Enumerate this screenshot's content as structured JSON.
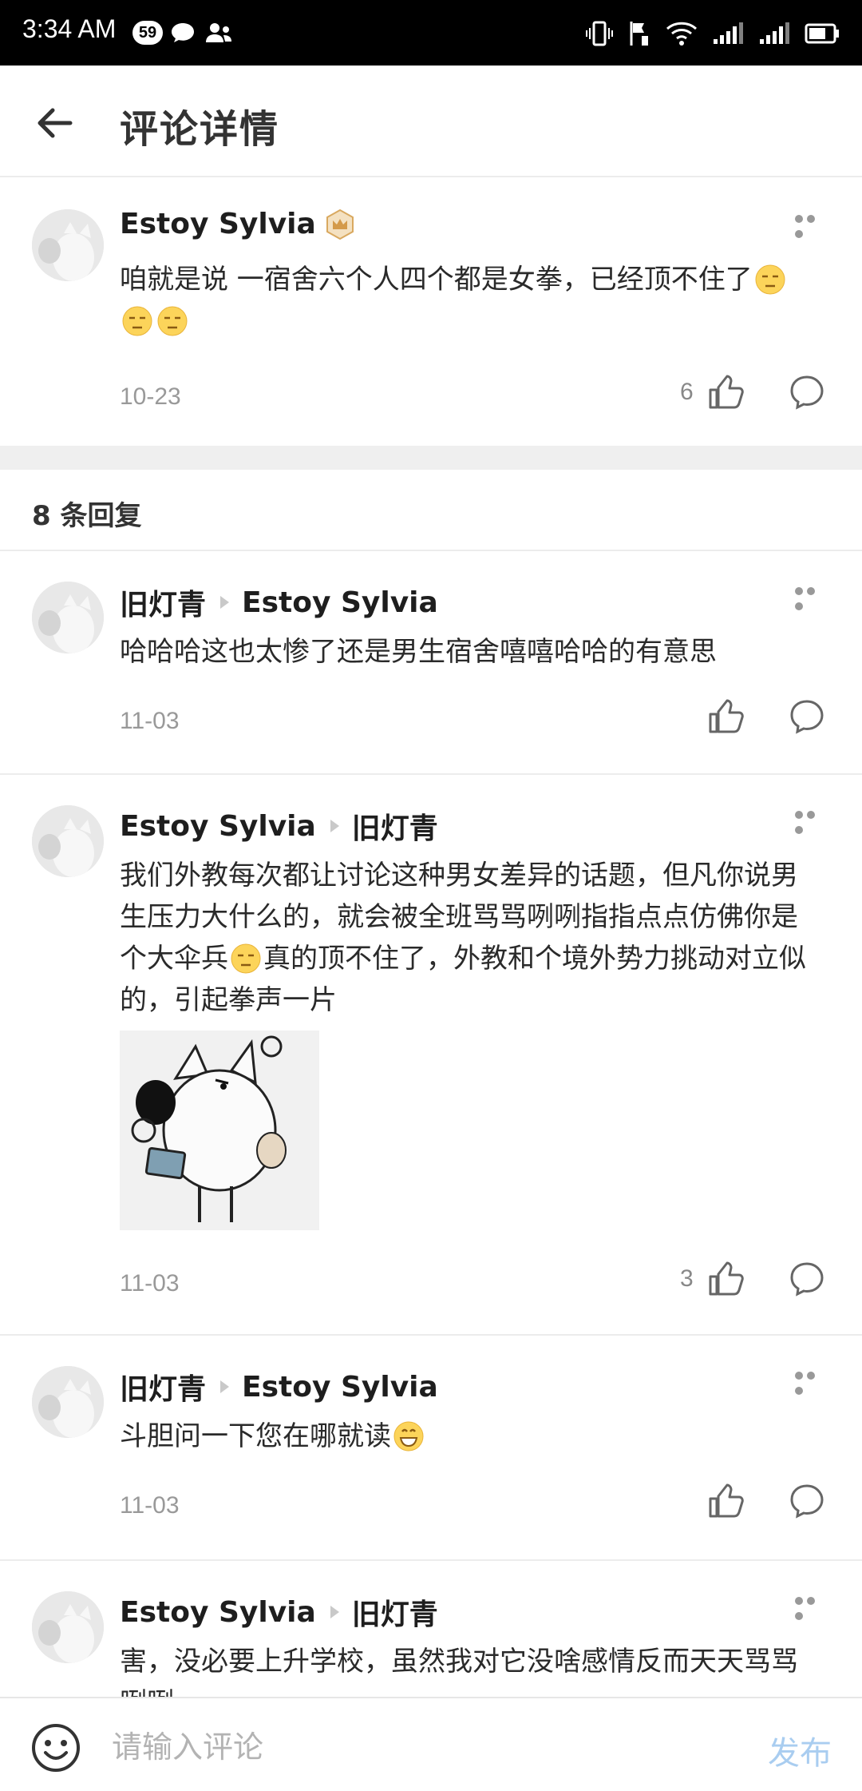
{
  "status_bar": {
    "time": "3:34 AM",
    "notification_count": "59",
    "icons": [
      "chat-icon",
      "contact-icon",
      "vibrate-icon",
      "flag-icon",
      "wifi-icon",
      "signal-icon",
      "signal-r-icon",
      "battery-icon"
    ]
  },
  "header": {
    "back_icon": "back-arrow-icon",
    "title": "评论详情"
  },
  "main_comment": {
    "author": "Estoy Sylvia",
    "author_badge_icon": "crown-badge-icon",
    "text": "咱就是说 一宿舍六个人四个都是女拳，已经顶不住了",
    "emojis": [
      "unamused-emoji",
      "unamused-emoji",
      "unamused-emoji"
    ],
    "date": "10-23",
    "likes": "6"
  },
  "replies_header": "8 条回复",
  "replies": [
    {
      "author": "旧灯青",
      "reply_to": "Estoy Sylvia",
      "text": "哈哈哈这也太惨了还是男生宿舍嘻嘻哈哈的有意思",
      "date": "11-03",
      "likes": ""
    },
    {
      "author": "Estoy Sylvia",
      "reply_to": "旧灯青",
      "text_part1": "我们外教每次都让讨论这种男女差异的话题，但凡你说男生压力大什么的，就会被全班骂骂咧咧指指点点仿佛你是个大伞兵",
      "text_part2": "真的顶不住了，外教和个境外势力挑动对立似的，引起拳声一片",
      "emoji": "unamused-emoji",
      "sticker": "dog-sticker-image",
      "date": "11-03",
      "likes": "3"
    },
    {
      "author": "旧灯青",
      "reply_to": "Estoy Sylvia",
      "text": "斗胆问一下您在哪就读",
      "emoji": "grin-emoji",
      "date": "11-03",
      "likes": ""
    },
    {
      "author": "Estoy Sylvia",
      "reply_to": "旧灯青",
      "text": "害，没必要上升学校，虽然我对它没啥感情反而天天骂骂咧咧",
      "date": "",
      "likes": ""
    }
  ],
  "bottom_bar": {
    "emoji_icon": "smiley-icon",
    "input_placeholder": "请输入评论",
    "input_value": "",
    "publish_label": "发布"
  },
  "colors": {
    "publish_disabled": "#a9cdf0",
    "date_text": "#999999",
    "divider": "#ececec"
  }
}
